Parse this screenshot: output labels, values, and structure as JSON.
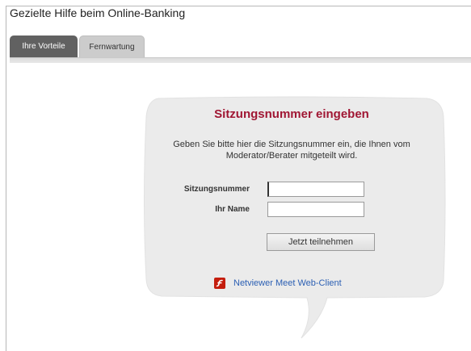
{
  "page": {
    "title": "Gezielte Hilfe beim Online-Banking"
  },
  "tabs": [
    {
      "label": "Ihre Vorteile",
      "active": false
    },
    {
      "label": "Fernwartung",
      "active": true
    }
  ],
  "session_form": {
    "headline": "Sitzungsnummer eingeben",
    "instruction": "Geben Sie bitte hier die Sitzungsnummer ein, die Ihnen vom Moderator/Berater mitgeteilt wird.",
    "fields": [
      {
        "label": "Sitzungsnummer",
        "value": "",
        "placeholder": ""
      },
      {
        "label": "Ihr Name",
        "value": "",
        "placeholder": ""
      }
    ],
    "submit_label": "Jetzt teilnehmen",
    "client_link": {
      "label": "Netviewer Meet Web-Client",
      "icon": "flash-icon"
    }
  },
  "colors": {
    "headline": "#a01633",
    "link": "#2b5fb3",
    "tab_dark": "#616161",
    "tab_light": "#cccccc",
    "bubble": "#ebebeb",
    "flash_icon": "#c41d0d"
  }
}
